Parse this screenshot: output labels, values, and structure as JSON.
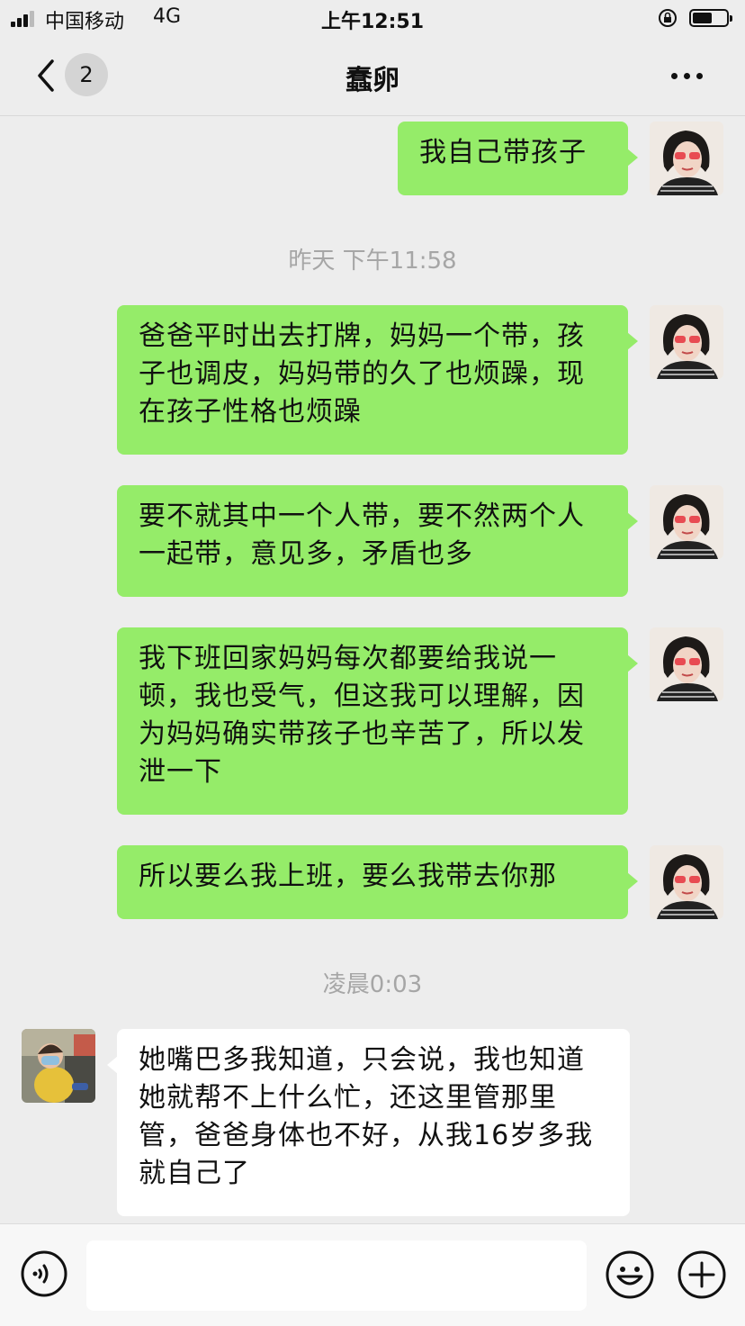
{
  "status": {
    "carrier": "中国移动",
    "network": "4G",
    "time": "上午12:51",
    "battery_level": 0.58
  },
  "nav": {
    "unread_count": "2",
    "title": "蠢卵"
  },
  "messages": [
    {
      "text": "我自己带孩子"
    },
    {
      "timestamp": "昨天 下午11:58"
    },
    {
      "text": " 爸爸平时出去打牌，妈妈一个带，孩子也调皮，妈妈带的久了也烦躁，现在孩子性格也烦躁"
    },
    {
      "text": "要不就其中一个人带，要不然两个人一起带，意见多，矛盾也多"
    },
    {
      "text": "我下班回家妈妈每次都要给我说一顿，我也受气，但这我可以理解，因为妈妈确实带孩子也辛苦了，所以发泄一下"
    },
    {
      "text": "所以要么我上班，要么我带去你那"
    },
    {
      "timestamp": "凌晨0:03"
    },
    {
      "text": "她嘴巴多我知道，只会说，我也知道她就帮不上什么忙，还这里管那里管，爸爸身体也不好，从我16岁多我就自己了"
    }
  ],
  "input": {
    "value": ""
  },
  "colors": {
    "outgoing_bubble": "#95ec69",
    "incoming_bubble": "#ffffff",
    "background": "#ededed"
  },
  "icons": {
    "back": "chevron-left-icon",
    "more": "more-dots-icon",
    "voice": "voice-icon",
    "emoji": "emoji-icon",
    "plus": "plus-icon"
  }
}
